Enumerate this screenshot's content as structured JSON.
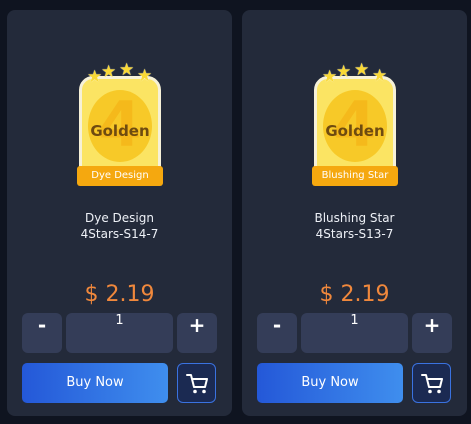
{
  "products": [
    {
      "badge": {
        "digit": "4",
        "word": "Golden",
        "ribbon": "Dye Design"
      },
      "name_line1": "Dye Design",
      "name_line2": "4Stars-S14-7",
      "price": "$ 2.19",
      "quantity": "1",
      "minus_label": "-",
      "plus_label": "+",
      "buy_label": "Buy Now"
    },
    {
      "badge": {
        "digit": "4",
        "word": "Golden",
        "ribbon": "Blushing Star"
      },
      "name_line1": "Blushing Star",
      "name_line2": "4Stars-S13-7",
      "price": "$ 2.19",
      "quantity": "1",
      "minus_label": "-",
      "plus_label": "+",
      "buy_label": "Buy Now"
    }
  ],
  "colors": {
    "page_bg": "#0f1420",
    "card_bg": "#232a3a",
    "price": "#f0883c",
    "badge_gold": "#f7c928",
    "button_blue": "#2f6fe3"
  },
  "icons": {
    "stars": "star-icon",
    "cart": "shopping-cart-icon"
  }
}
